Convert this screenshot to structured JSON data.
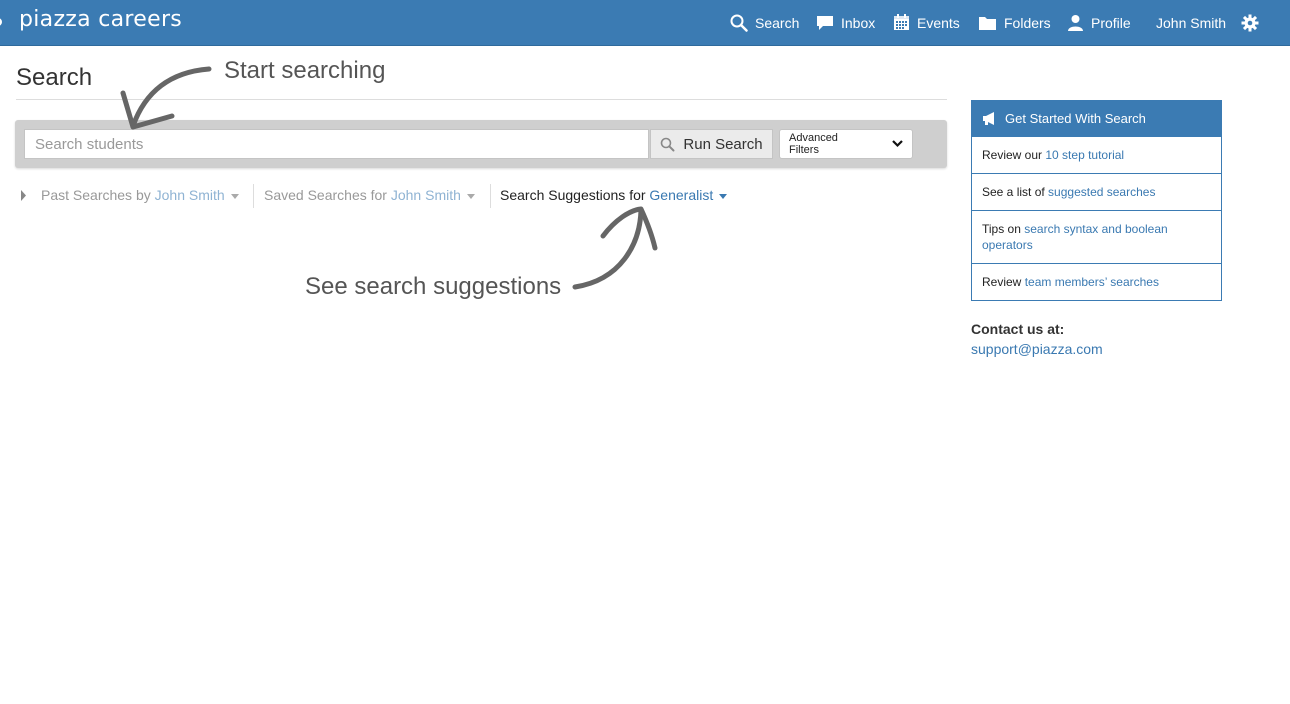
{
  "brand": {
    "name": "piazza careers"
  },
  "nav": {
    "items": [
      {
        "label": "Search",
        "icon": "search-icon"
      },
      {
        "label": "Inbox",
        "icon": "chat-bubble-icon"
      },
      {
        "label": "Events",
        "icon": "calendar-icon"
      },
      {
        "label": "Folders",
        "icon": "folder-icon"
      },
      {
        "label": "Profile",
        "icon": "user-icon"
      }
    ],
    "user_name": "John Smith",
    "settings_icon": "gear-icon"
  },
  "page": {
    "title": "Search"
  },
  "search": {
    "placeholder": "Search students",
    "value": "",
    "run_label": "Run Search",
    "advanced_filters_label": "Advanced Filters"
  },
  "tabs": {
    "past": {
      "prefix": "Past Searches by",
      "name": "John Smith"
    },
    "saved": {
      "prefix": "Saved Searches for",
      "name": "John Smith"
    },
    "suggestions": {
      "prefix": "Search Suggestions for",
      "name": "Generalist"
    }
  },
  "annotations": {
    "start": "Start searching",
    "suggestions": "See search suggestions"
  },
  "sidebar": {
    "header": "Get Started With Search",
    "rows": [
      {
        "text": "Review our",
        "link": "10 step tutorial"
      },
      {
        "text": "See a list of",
        "link": "suggested searches"
      },
      {
        "text": "Tips on",
        "link": "search syntax and boolean operators"
      },
      {
        "text": "Review",
        "link": "team members’ searches"
      }
    ],
    "contact_title": "Contact us at:",
    "contact_email": "support@piazza.com"
  },
  "colors": {
    "brand_blue": "#3b7bb3",
    "link_blue": "#3a79b1",
    "muted_text": "#999999",
    "annotation_gray": "#555555"
  }
}
